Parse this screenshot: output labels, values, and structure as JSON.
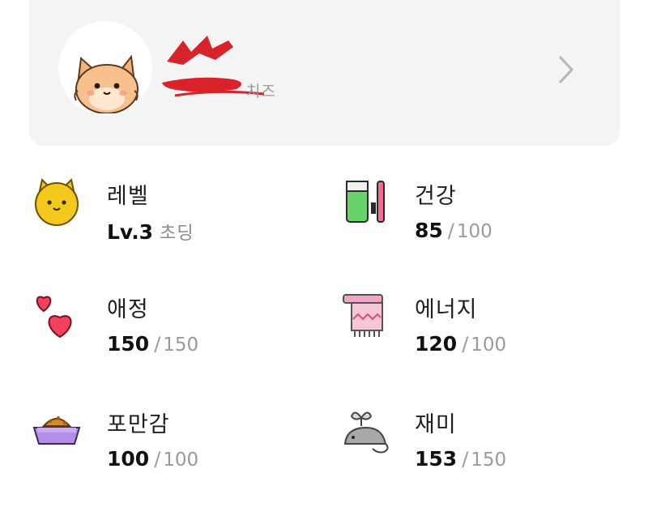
{
  "profile": {
    "name": "",
    "subtitle": "치즈",
    "avatar_icon": "cat-avatar-icon",
    "chevron_icon": "chevron-right-icon"
  },
  "stats": {
    "level": {
      "label": "레벨",
      "level_text": "Lv.3",
      "level_name": "초딩",
      "icon": "yellow-cat-icon"
    },
    "health": {
      "label": "건강",
      "current": "85",
      "slash": "/",
      "max": "100",
      "icon": "toothpaste-icon"
    },
    "affection": {
      "label": "애정",
      "current": "150",
      "slash": "/",
      "max": "150",
      "icon": "hearts-icon"
    },
    "energy": {
      "label": "에너지",
      "current": "120",
      "slash": "/",
      "max": "100",
      "icon": "towel-icon"
    },
    "fullness": {
      "label": "포만감",
      "current": "100",
      "slash": "/",
      "max": "100",
      "icon": "food-bowl-icon"
    },
    "fun": {
      "label": "재미",
      "current": "153",
      "slash": "/",
      "max": "150",
      "icon": "mouse-toy-icon"
    }
  },
  "colors": {
    "card_bg": "#f4f4f4",
    "redaction": "#d8232a",
    "muted_text": "#9a9a9a"
  }
}
